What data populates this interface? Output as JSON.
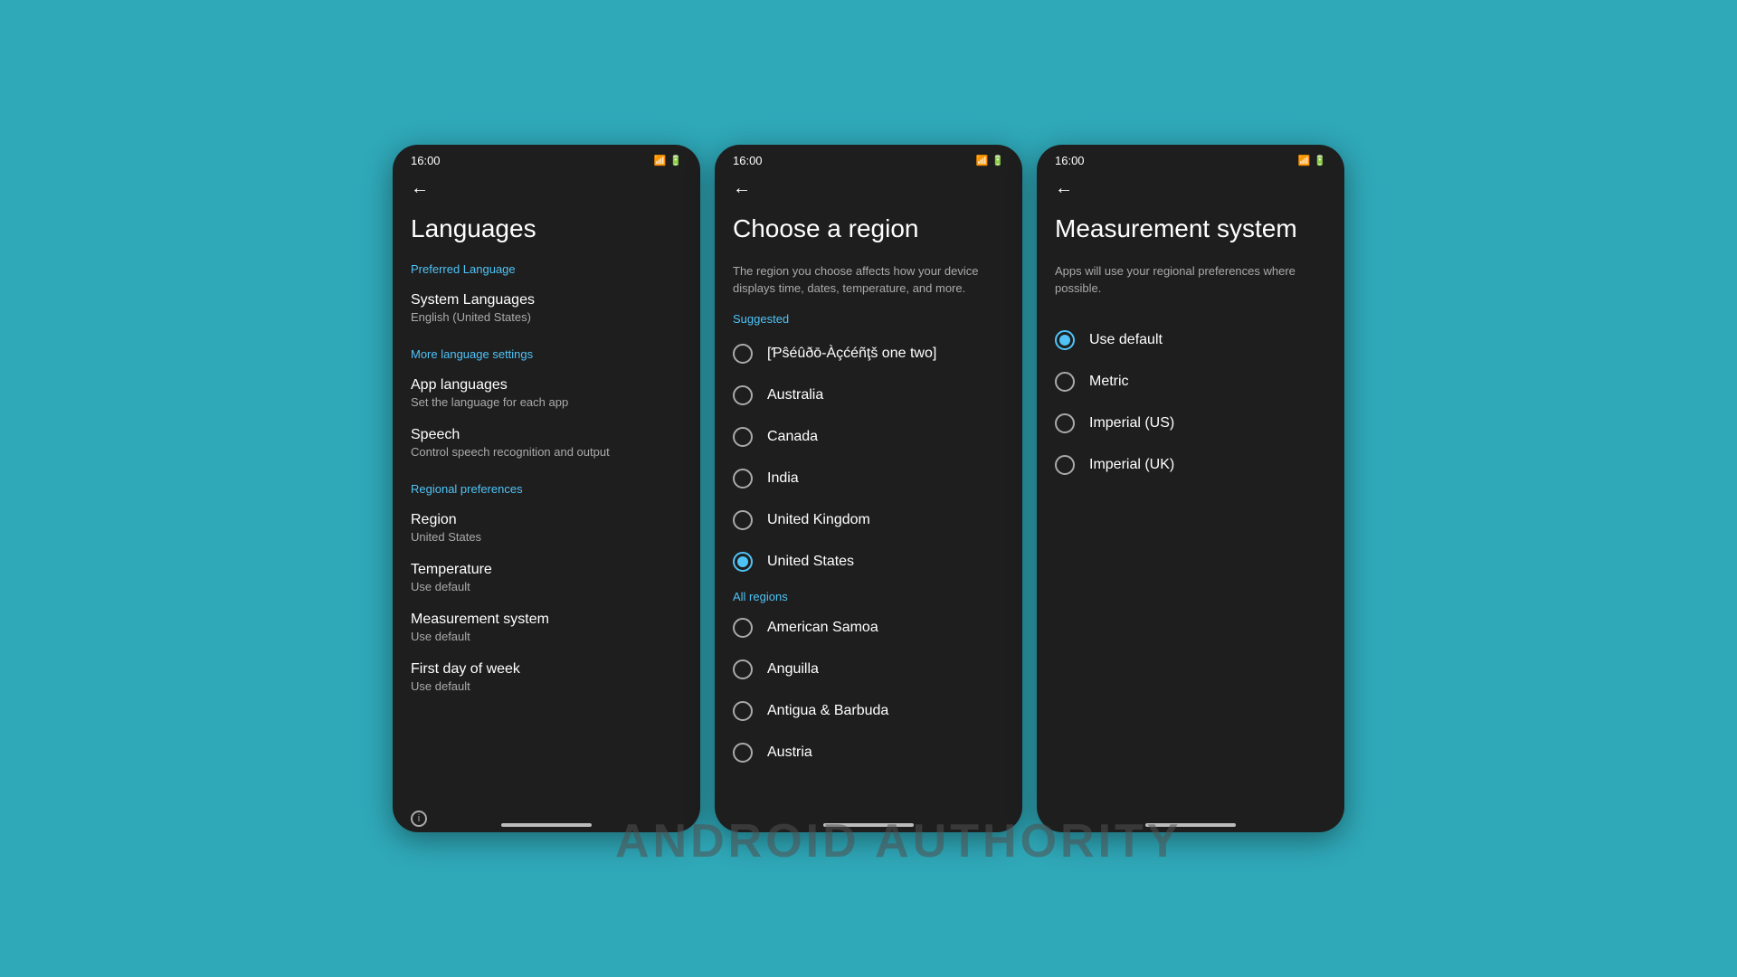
{
  "background_color": "#2fa8b8",
  "watermark": "ANDROID AUTHORITY",
  "phones": [
    {
      "id": "languages",
      "status_time": "16:00",
      "page_title": "Languages",
      "sections": [
        {
          "label": "Preferred Language",
          "items": [
            {
              "title": "System Languages",
              "subtitle": "English (United States)"
            }
          ]
        },
        {
          "label": "More language settings",
          "is_link": true,
          "items": [
            {
              "title": "App languages",
              "subtitle": "Set the language for each app"
            },
            {
              "title": "Speech",
              "subtitle": "Control speech recognition and output"
            }
          ]
        },
        {
          "label": "Regional preferences",
          "items": [
            {
              "title": "Region",
              "subtitle": "United States"
            },
            {
              "title": "Temperature",
              "subtitle": "Use default"
            },
            {
              "title": "Measurement system",
              "subtitle": "Use default"
            },
            {
              "title": "First day of week",
              "subtitle": "Use default"
            }
          ]
        }
      ]
    },
    {
      "id": "region",
      "status_time": "16:00",
      "page_title": "Choose a region",
      "description": "The region you choose affects how your device displays time, dates, temperature, and more.",
      "suggested_label": "Suggested",
      "all_regions_label": "All regions",
      "suggested_items": [
        {
          "label": "[Ƥŝéûðō-Àçćéñţš one two]",
          "selected": false
        },
        {
          "label": "Australia",
          "selected": false
        },
        {
          "label": "Canada",
          "selected": false
        },
        {
          "label": "India",
          "selected": false
        },
        {
          "label": "United Kingdom",
          "selected": false
        },
        {
          "label": "United States",
          "selected": true
        }
      ],
      "all_region_items": [
        {
          "label": "American Samoa",
          "selected": false
        },
        {
          "label": "Anguilla",
          "selected": false
        },
        {
          "label": "Antigua & Barbuda",
          "selected": false
        },
        {
          "label": "Austria",
          "selected": false
        }
      ]
    },
    {
      "id": "measurement",
      "status_time": "16:00",
      "page_title": "Measurement system",
      "description": "Apps will use your regional preferences where possible.",
      "options": [
        {
          "label": "Use default",
          "selected": true
        },
        {
          "label": "Metric",
          "selected": false
        },
        {
          "label": "Imperial (US)",
          "selected": false
        },
        {
          "label": "Imperial (UK)",
          "selected": false
        }
      ]
    }
  ]
}
